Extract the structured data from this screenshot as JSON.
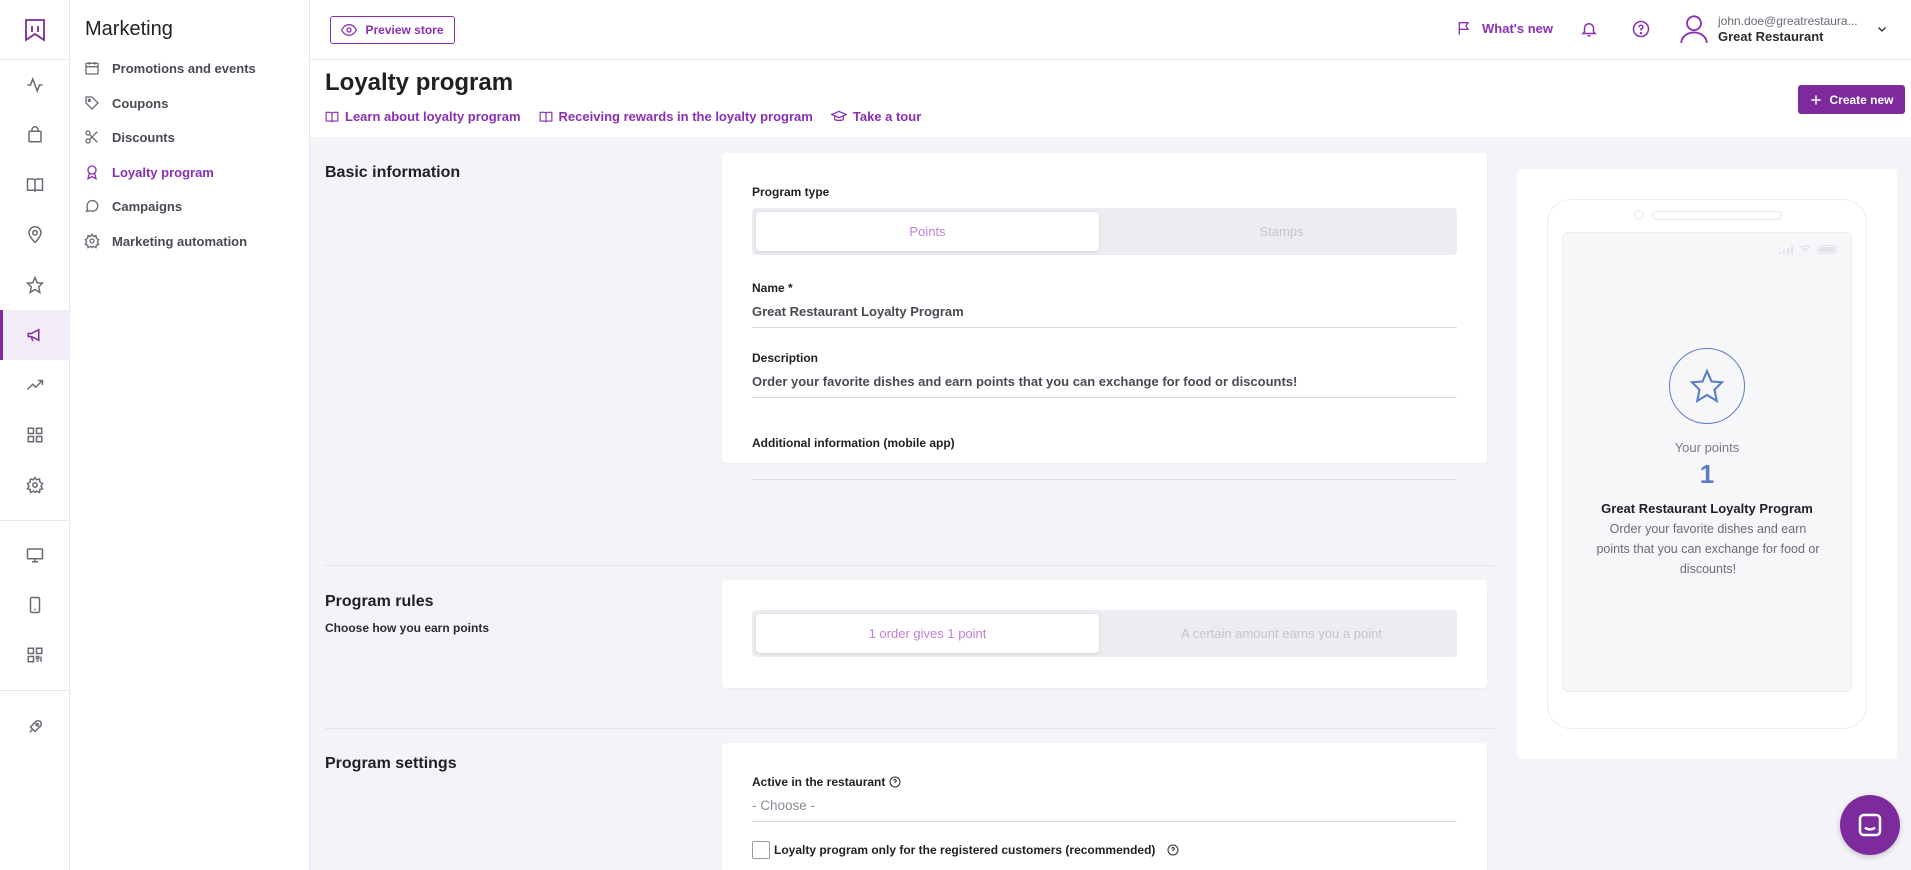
{
  "subnav": {
    "title": "Marketing",
    "items": [
      {
        "label": "Promotions and events",
        "icon": "calendar-icon"
      },
      {
        "label": "Coupons",
        "icon": "tag-icon"
      },
      {
        "label": "Discounts",
        "icon": "scissors-icon"
      },
      {
        "label": "Loyalty program",
        "icon": "award-icon",
        "active": true
      },
      {
        "label": "Campaigns",
        "icon": "chat-icon"
      },
      {
        "label": "Marketing automation",
        "icon": "gear-icon"
      }
    ]
  },
  "rail": {
    "icons": [
      "logo-icon",
      "activity-icon",
      "shopping-bag-icon",
      "book-icon",
      "location-pin-icon",
      "star-icon",
      "megaphone-icon",
      "trending-icon",
      "apps-icon",
      "settings-icon",
      "monitor-icon",
      "mobile-icon",
      "qr-code-icon",
      "rocket-icon"
    ],
    "active": "megaphone-icon"
  },
  "topbar": {
    "preview_label": "Preview store",
    "whats_new_label": "What's new",
    "user_email": "john.doe@greatrestaura...",
    "user_restaurant": "Great Restaurant"
  },
  "page": {
    "title": "Loyalty program",
    "links": [
      {
        "label": "Learn about loyalty program",
        "icon": "book-open-icon"
      },
      {
        "label": "Receiving rewards in the loyalty program",
        "icon": "book-open-icon"
      },
      {
        "label": "Take a tour",
        "icon": "graduation-cap-icon"
      }
    ],
    "create_label": "Create new"
  },
  "basic": {
    "title": "Basic information",
    "program_type_label": "Program type",
    "type_options": [
      "Points",
      "Stamps"
    ],
    "type_selected": "Points",
    "name_label": "Name *",
    "name_value": "Great Restaurant Loyalty Program",
    "description_label": "Description",
    "description_value": "Order your favorite dishes and earn points that you can exchange for food or discounts!",
    "additional_label": "Additional information (mobile app)",
    "additional_value": ""
  },
  "rules": {
    "title": "Program rules",
    "subtitle": "Choose how you earn points",
    "options": [
      "1 order gives 1 point",
      "A certain amount earns you a point"
    ],
    "selected": "1 order gives 1 point"
  },
  "settings": {
    "title": "Program settings",
    "active_label": "Active in the restaurant",
    "active_placeholder": "- Choose -",
    "registered_label": "Loyalty program only for the registered customers (recommended)",
    "registered_checked": false
  },
  "preview": {
    "points_label": "Your points",
    "points_value": "1",
    "program_name": "Great Restaurant Loyalty Program",
    "program_desc": "Order your favorite dishes and earn points that you can exchange for food or discounts!"
  },
  "colors": {
    "accent": "#8a2fb4",
    "accent_dark": "#7c2a9c",
    "preview_blue": "#5b7dc8"
  }
}
